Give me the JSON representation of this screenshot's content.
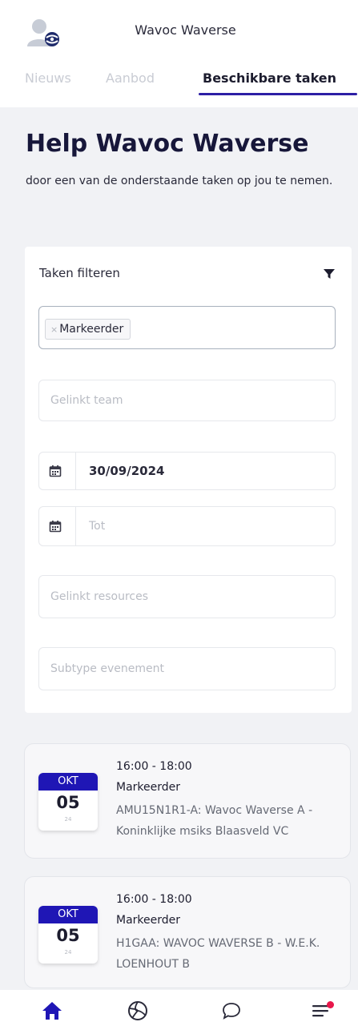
{
  "header": {
    "club_name": "Wavoc Waverse",
    "tabs": [
      {
        "label": "Nieuws",
        "active": false
      },
      {
        "label": "Aanbod",
        "active": false
      },
      {
        "label": "Beschikbare taken",
        "active": true
      }
    ]
  },
  "main": {
    "title": "Help Wavoc Waverse",
    "subtitle": "door een van de onderstaande taken op jou te nemen."
  },
  "filters": {
    "title": "Taken filteren",
    "selected_tag": "Markeerder",
    "team_placeholder": "Gelinkt team",
    "from_date": "30/09/2024",
    "to_placeholder": "Tot",
    "resources_placeholder": "Gelinkt resources",
    "subtype_placeholder": "Subtype evenement"
  },
  "tasks": [
    {
      "month": "OKT",
      "day": "05",
      "year": "24",
      "time": "16:00 - 18:00",
      "role": "Markeerder",
      "description": "AMU15N1R1-A: Wavoc Waverse A - Koninklijke msiks Blaasveld VC"
    },
    {
      "month": "OKT",
      "day": "05",
      "year": "24",
      "time": "16:00 - 18:00",
      "role": "Markeerder",
      "description": "H1GAA: WAVOC WAVERSE B - W.E.K. LOENHOUT B"
    }
  ],
  "colors": {
    "accent": "#2d1fa5",
    "badge_month_bg": "#1f16b5",
    "notification_dot": "#e8174a"
  },
  "icons": {
    "filter": "filter-funnel-icon",
    "calendar": "calendar-icon",
    "nav": [
      "home-icon",
      "volleyball-icon",
      "chat-bubble-icon",
      "menu-icon"
    ]
  }
}
